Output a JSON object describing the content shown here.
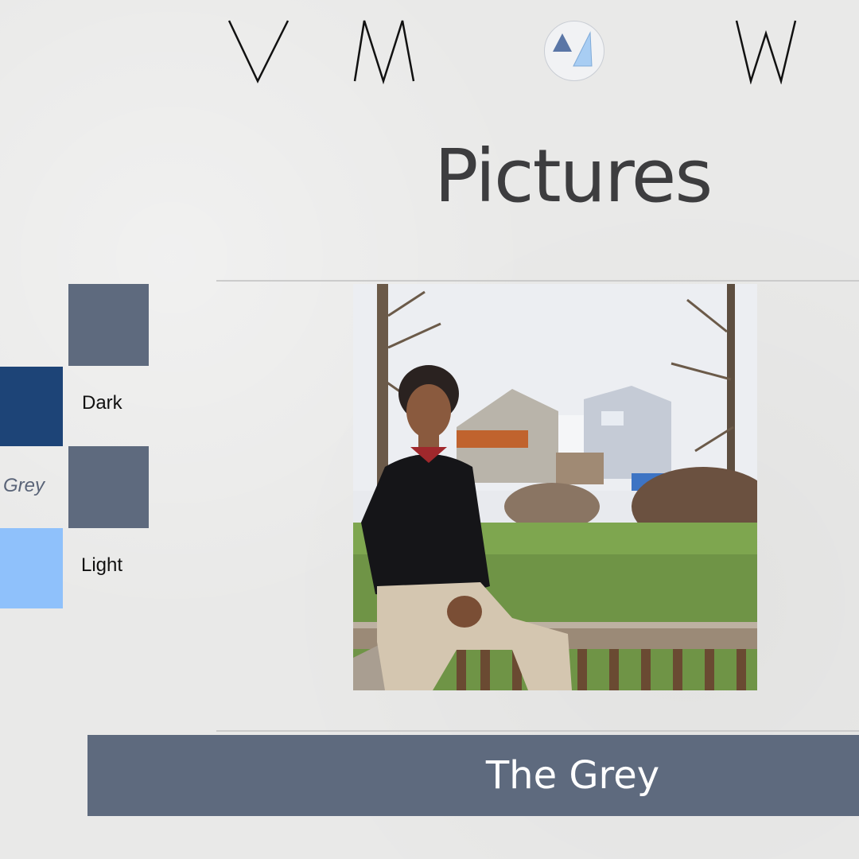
{
  "nav": {
    "items": [
      {
        "letter": "V",
        "icon": "v-letter-icon"
      },
      {
        "letter": "M",
        "icon": "m-letter-icon"
      },
      {
        "icon": "triangles-logo-icon"
      },
      {
        "letter": "W",
        "icon": "w-letter-icon"
      }
    ]
  },
  "page": {
    "title": "Pictures"
  },
  "palette": {
    "swatches": [
      {
        "name": "grey-top",
        "color": "#5e6a7e"
      },
      {
        "name": "dark",
        "color": "#1d4477"
      },
      {
        "name": "grey",
        "color": "#5e6a7e"
      },
      {
        "name": "light",
        "color": "#8fc1fb"
      }
    ],
    "labels": {
      "dark": "Dark",
      "grey": "Grey",
      "light": "Light"
    }
  },
  "photo": {
    "subject": "person-sitting-on-deck-railing"
  },
  "caption": {
    "text": "The Grey"
  },
  "colors": {
    "accent_grey": "#5e6a7e",
    "dark_blue": "#1d4477",
    "light_blue": "#8fc1fb",
    "background": "#e9e9e8"
  }
}
